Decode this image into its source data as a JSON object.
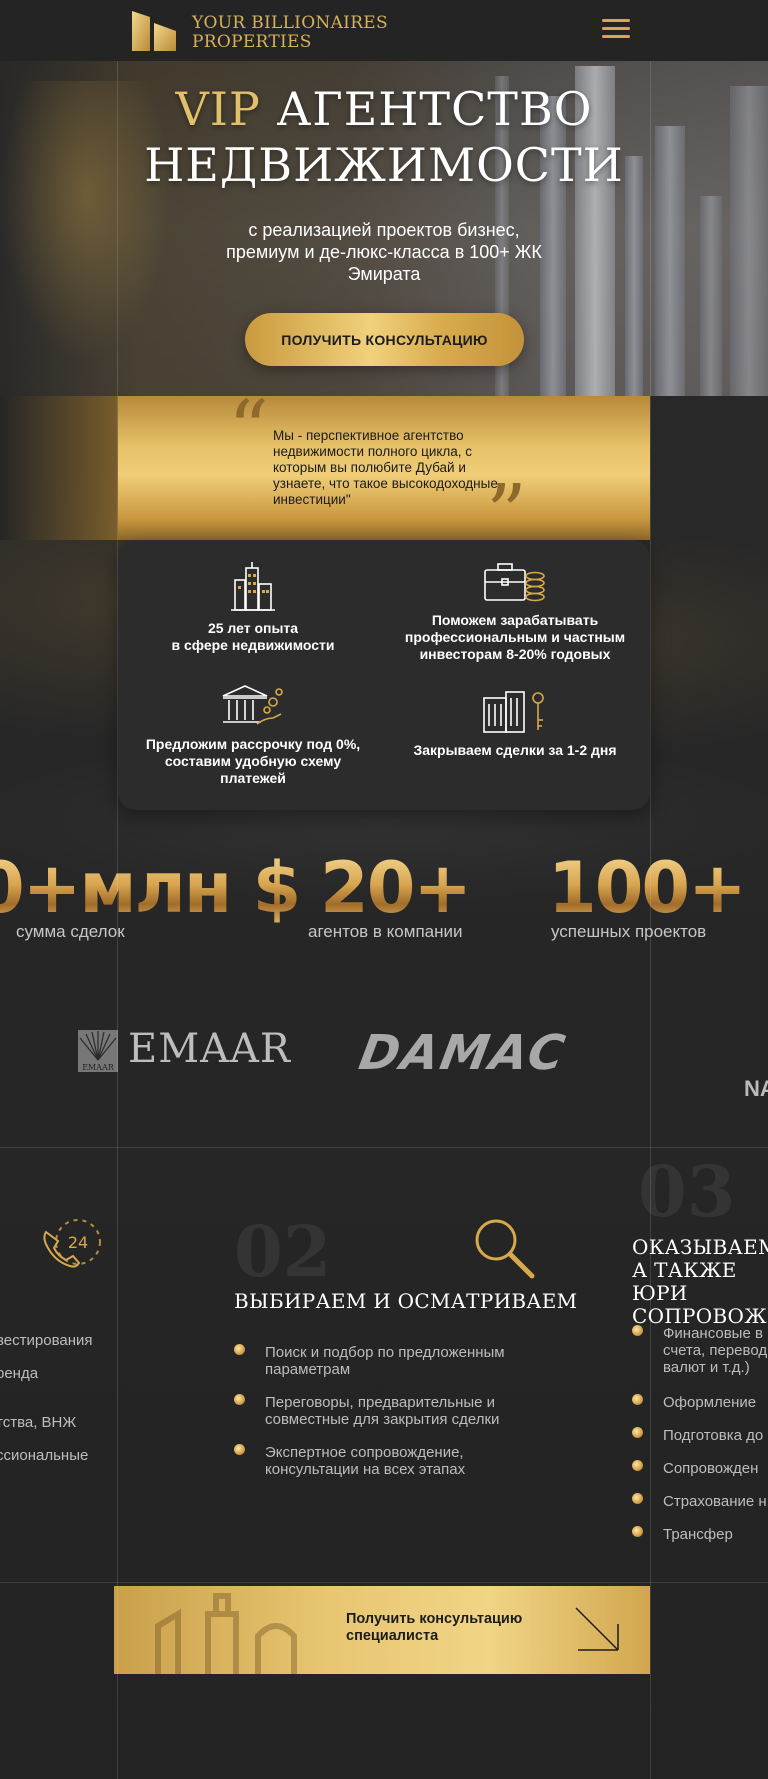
{
  "header": {
    "logo_line1": "YOUR BILLIONAIRES",
    "logo_line2": "PROPERTIES"
  },
  "hero": {
    "title_vip": "VIP",
    "title_rest": "АГЕНТСТВО",
    "title_line2": "НЕДВИЖИМОСТИ",
    "subtitle": "с реализацией проектов бизнес, премиум и де-люкс-класса в 100+ ЖК Эмирата",
    "cta_label": "ПОЛУЧИТЬ КОНСУЛЬТАЦИЮ"
  },
  "quote": {
    "text": "Мы - перспективное агентство недвижимости полного цикла, с которым вы полюбите Дубай и узнаете, что такое высокодоходные инвестиции\""
  },
  "features": [
    {
      "icon": "buildings-icon",
      "line1": "25 лет опыта",
      "line2": "в сфере недвижимости",
      "line3": ""
    },
    {
      "icon": "briefcase-coins-icon",
      "line1": "Поможем зарабатывать",
      "line2": "профессиональным и частным",
      "line3": "инвесторам 8-20% годовых"
    },
    {
      "icon": "bank-hand-coins-icon",
      "line1": "Предложим рассрочку под 0%,",
      "line2": "составим удобную схему",
      "line3": "платежей"
    },
    {
      "icon": "building-key-icon",
      "line1": "Закрываем сделки за 1-2 дня",
      "line2": "",
      "line3": ""
    }
  ],
  "stats": [
    {
      "value": "0+млн $",
      "label": "сумма сделок"
    },
    {
      "value": "20+",
      "label": "агентов в компании"
    },
    {
      "value": "100+",
      "label": "успешных проектов"
    }
  ],
  "partners": {
    "emaar": "EMAAR",
    "emaar_small": "EMAAR",
    "damac": "DAMAC",
    "cut_off": "NA"
  },
  "steps": {
    "step1": {
      "items": [
        "вестирования",
        "ренда",
        "тства, ВНЖ",
        "ссиональные"
      ]
    },
    "step2": {
      "number": "02",
      "title": "ВЫБИРАЕМ И ОСМАТРИВАЕМ",
      "items": [
        {
          "l1": "Поиск и подбор по предложенным",
          "l2": "параметрам"
        },
        {
          "l1": "Переговоры, предварительные и",
          "l2": "совместные для закрытия сделки"
        },
        {
          "l1": "Экспертное сопровождение,",
          "l2": "консультации на всех этапах"
        }
      ]
    },
    "step3": {
      "number": "03",
      "title_l1": "ОКАЗЫВАЕМ З",
      "title_l2": "А ТАКЖЕ ЮРИ",
      "title_l3": "СОПРОВОЖДЕ",
      "items": [
        {
          "l1": "Финансовые в",
          "l2": "счета, перевод",
          "l3": "валют и т.д.)"
        },
        {
          "l1": "Оформление"
        },
        {
          "l1": "Подготовка до"
        },
        {
          "l1": "Сопровожден"
        },
        {
          "l1": "Страхование н"
        },
        {
          "l1": "Трансфер"
        }
      ]
    },
    "phone_badge": "24"
  },
  "bottom_cta": {
    "line1": "Получить консультацию",
    "line2": "специалиста"
  },
  "colors": {
    "accent_gold": "#d6a94a",
    "background": "#262626"
  }
}
